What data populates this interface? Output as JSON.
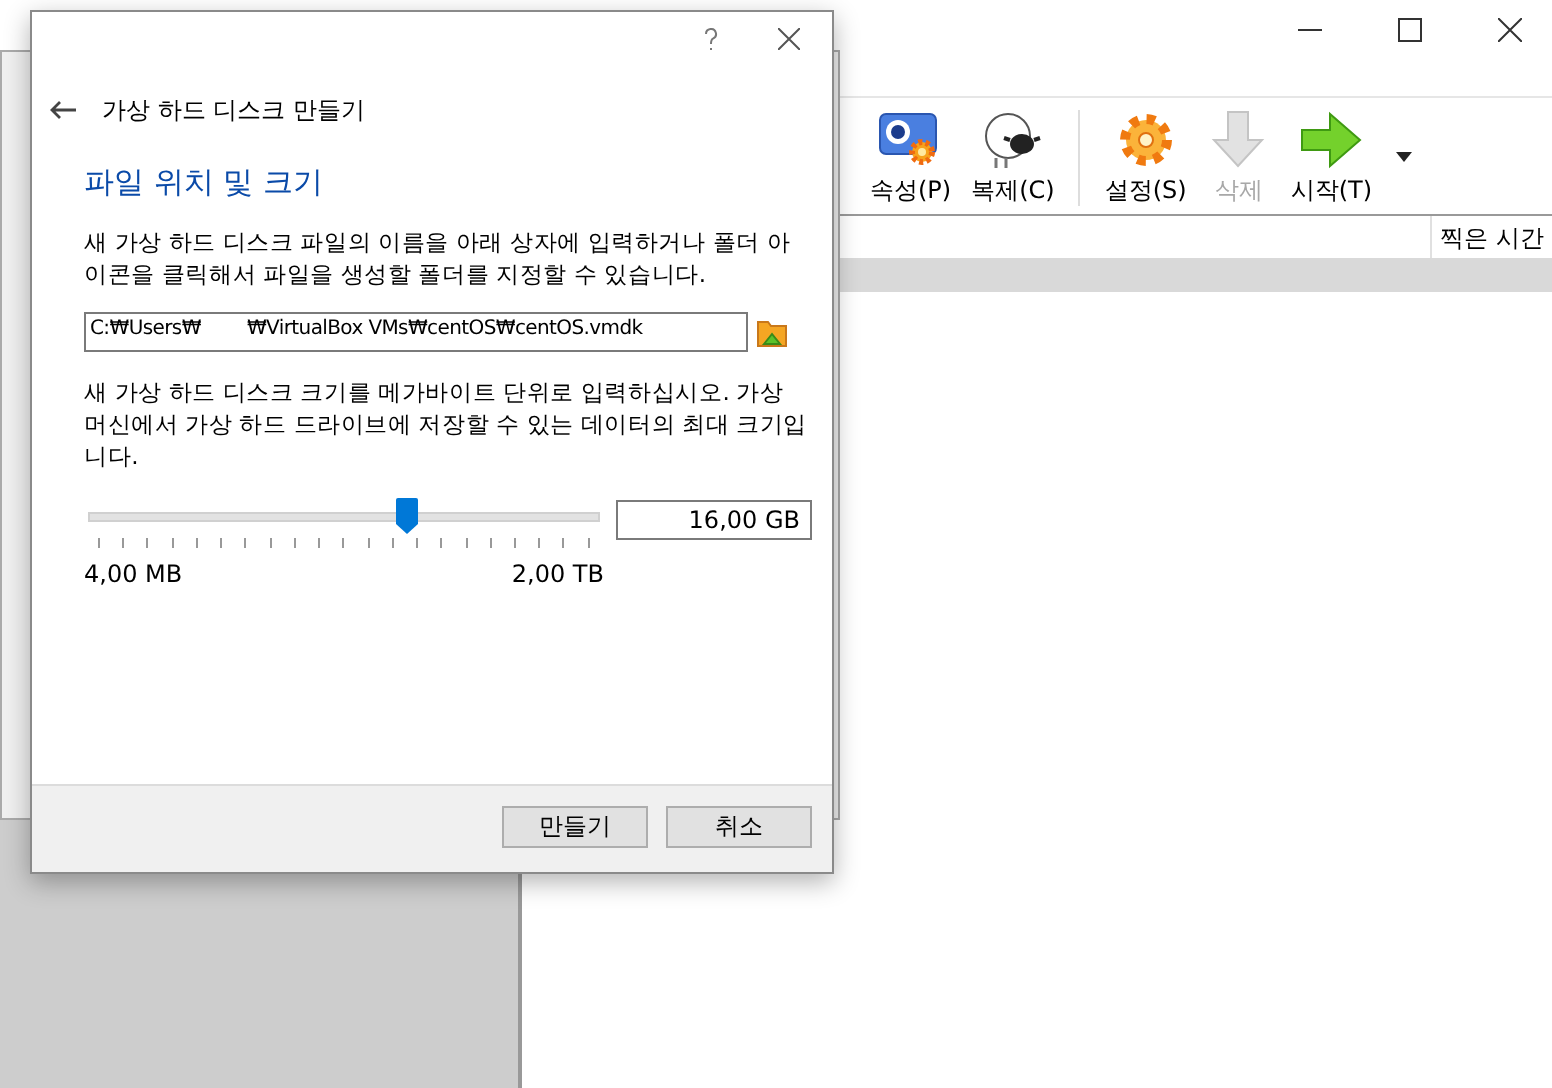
{
  "main_window": {
    "toolbar": [
      {
        "label": "속성(P)",
        "kind": "properties",
        "disabled": false
      },
      {
        "label": "복제(C)",
        "kind": "clone",
        "disabled": false
      },
      {
        "label": "설정(S)",
        "kind": "settings",
        "disabled": false
      },
      {
        "label": "삭제",
        "kind": "delete",
        "disabled": true
      },
      {
        "label": "시작(T)",
        "kind": "start",
        "disabled": false
      }
    ],
    "table": {
      "columns": [
        "찍은 시간"
      ]
    }
  },
  "dialog": {
    "title": "가상 하드 디스크 만들기",
    "heading": "파일 위치 및 크기",
    "location_text": "새 가상 하드 디스크 파일의 이름을 아래 상자에 입력하거나 폴더 아이콘을 클릭해서 파일을 생성할 폴더를 지정할 수 있습니다.",
    "file_path": "C:₩Users₩        ₩VirtualBox VMs₩centOS₩centOS.vmdk",
    "size_text": "새 가상 하드 디스크 크기를 메가바이트 단위로 입력하십시오. 가상 머신에서 가상 하드 드라이브에 저장할 수 있는 데이터의 최대 크기입니다.",
    "size": {
      "level": 0.62,
      "value": "16,00 GB",
      "min_label": "4,00 MB",
      "max_label": "2,00 TB"
    },
    "buttons": [
      "만들기",
      "취소"
    ]
  }
}
